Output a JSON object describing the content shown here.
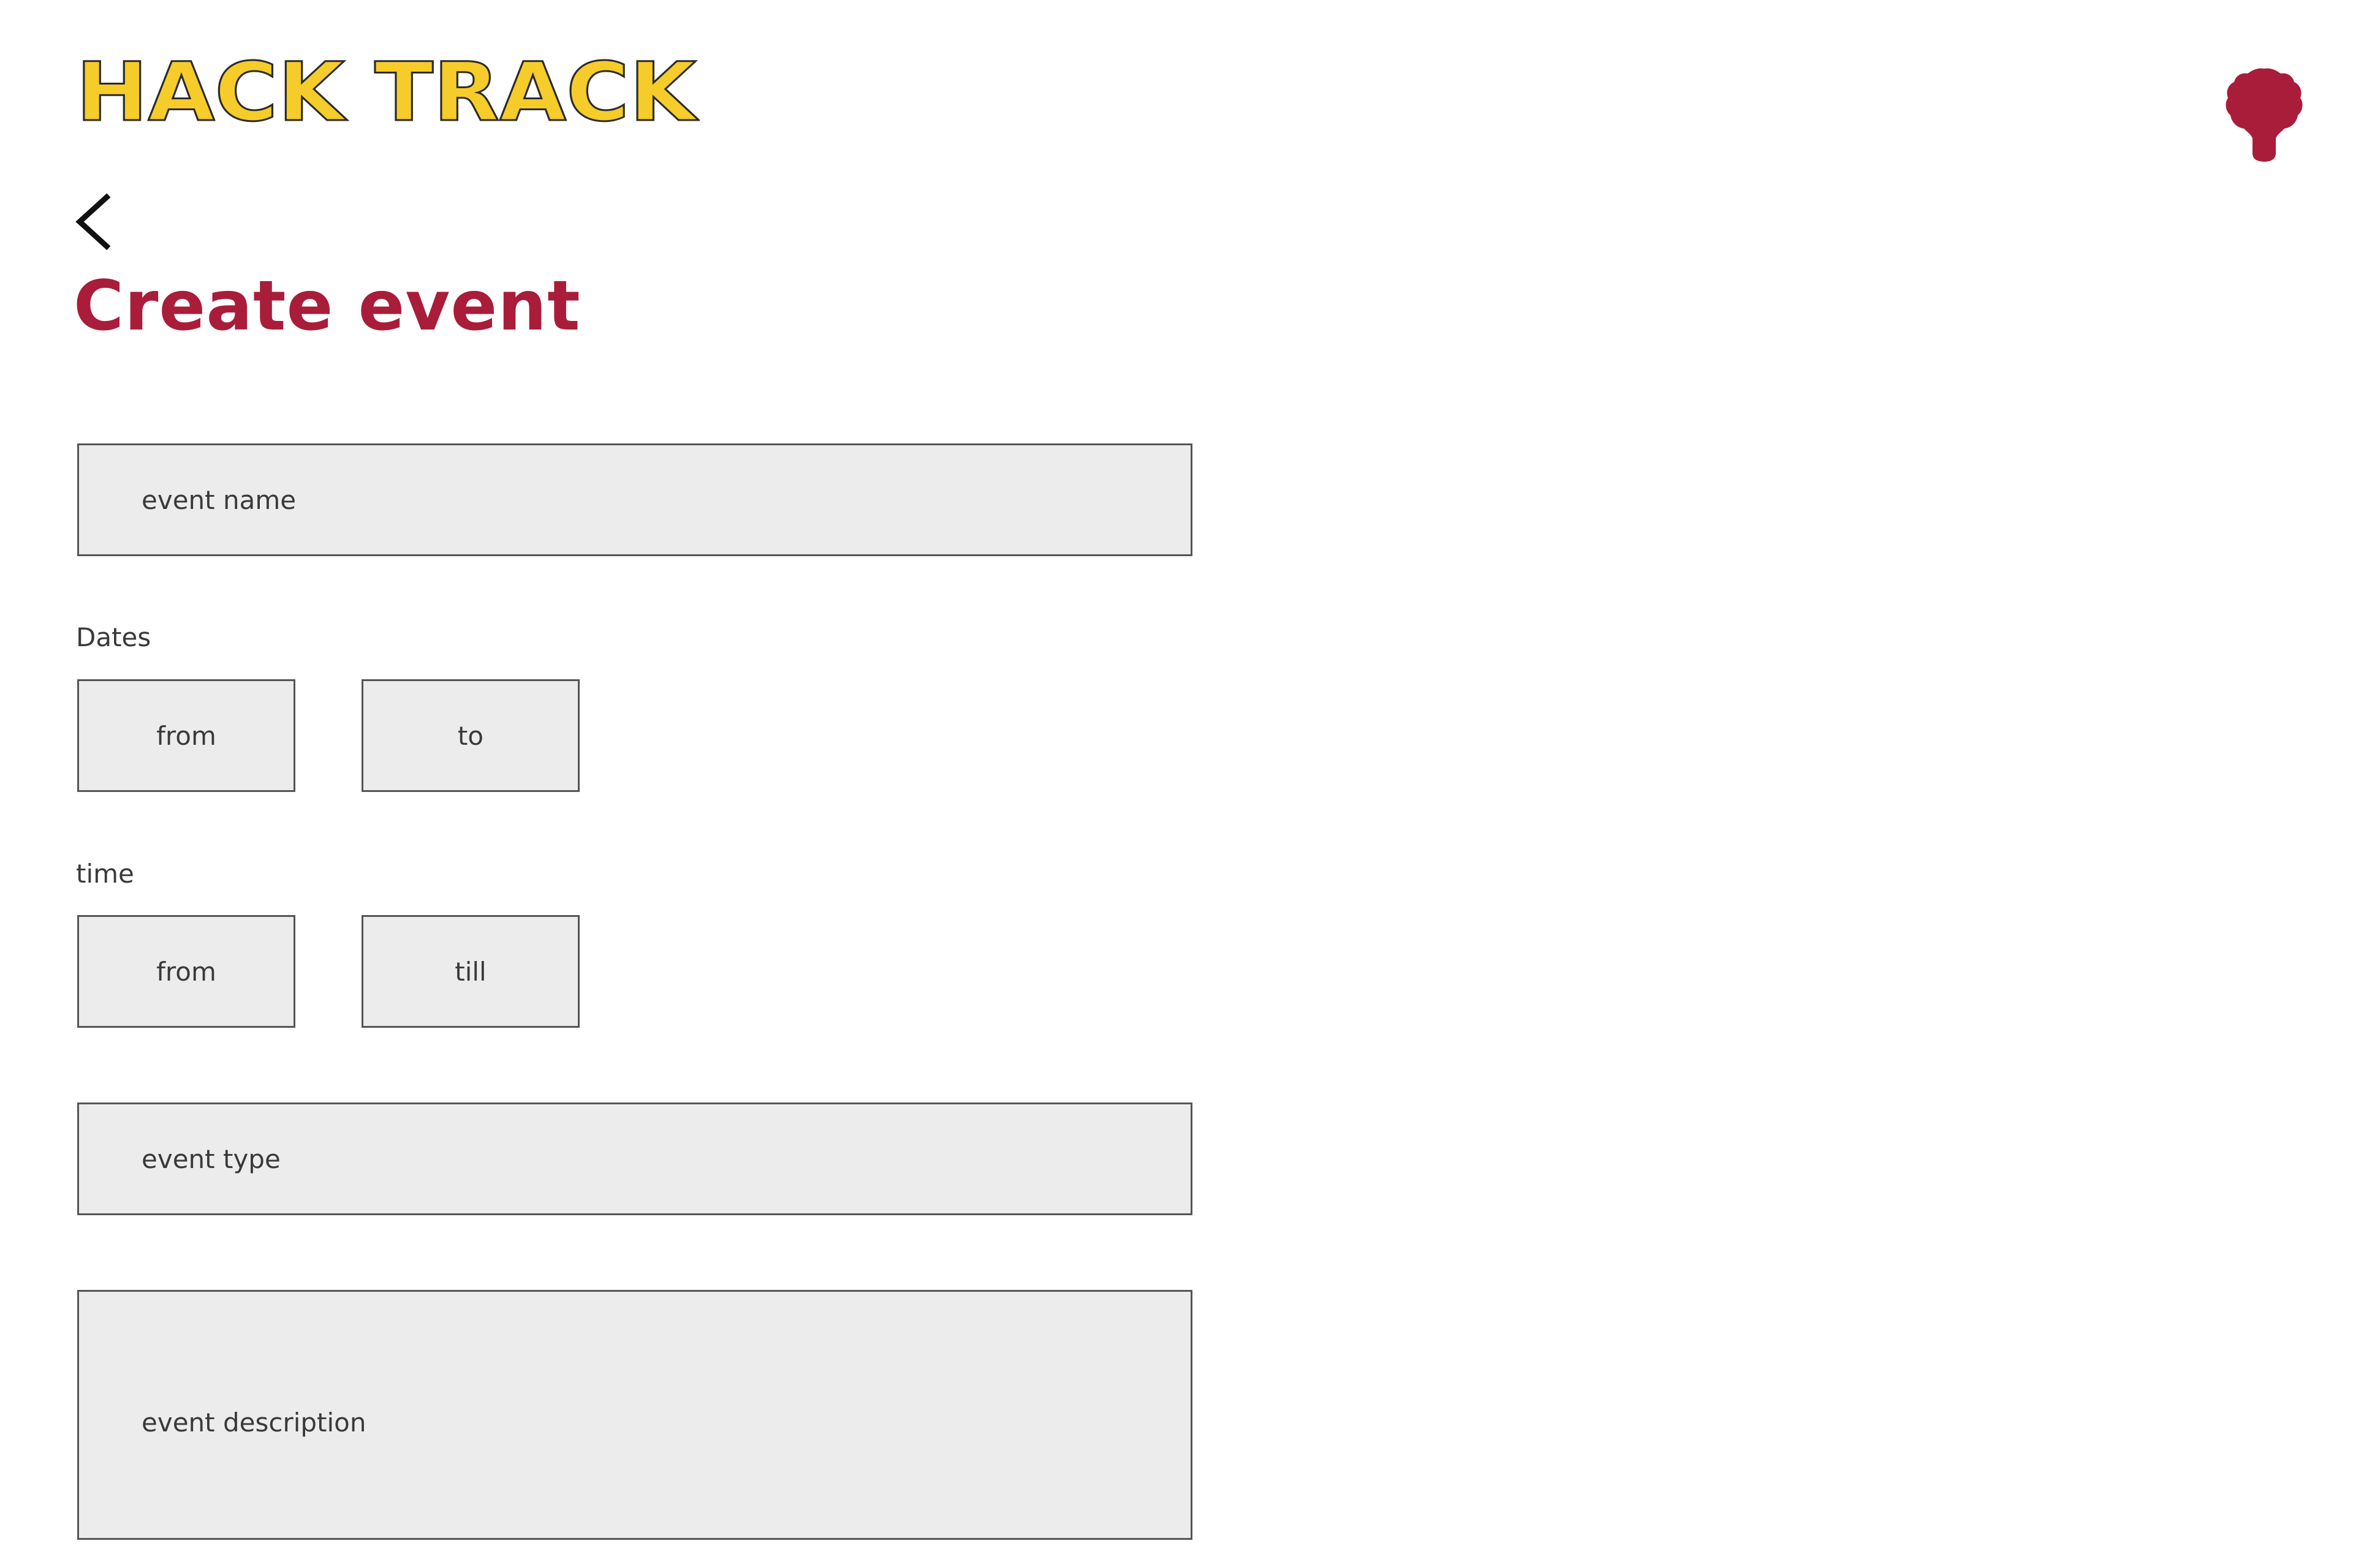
{
  "header": {
    "logo_text": "HACK TRACK",
    "avatar_icon": "user-avatar-icon"
  },
  "navigation": {
    "back_icon": "chevron-left-icon"
  },
  "page": {
    "title": "Create event"
  },
  "form": {
    "event_name_placeholder": "event name",
    "dates_label": "Dates",
    "dates_from_placeholder": "from",
    "dates_to_placeholder": "to",
    "time_label": "time",
    "time_from_placeholder": "from",
    "time_till_placeholder": "till",
    "event_type_placeholder": "event type",
    "event_description_placeholder": "event description"
  },
  "colors": {
    "brand_red": "#a91d3a",
    "logo_yellow": "#f5cc2a",
    "field_background": "#ececec"
  }
}
